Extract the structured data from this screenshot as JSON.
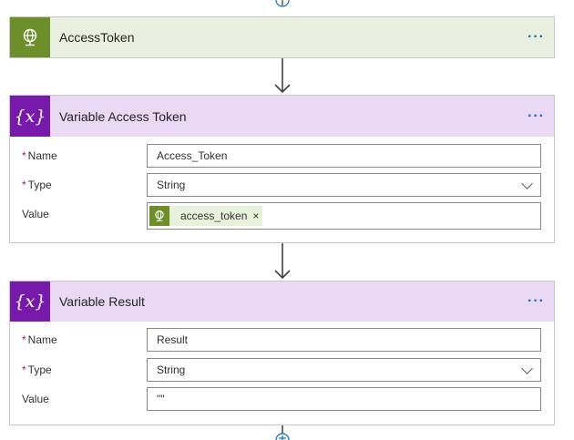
{
  "steps": {
    "access_token": {
      "title": "AccessToken",
      "icon": "globe-icon",
      "header_color": "#6c8e2b",
      "header_bg": "#e9f0df"
    },
    "var_access_token": {
      "title": "Variable Access Token",
      "icon": "variable-icon",
      "icon_text": "{x}",
      "header_color": "#7719aa",
      "header_bg": "#ead9f5",
      "name_label": "Name",
      "name_value": "Access_Token",
      "type_label": "Type",
      "type_value": "String",
      "value_label": "Value",
      "value_token": "access_token",
      "token_remove": "×"
    },
    "var_result": {
      "title": "Variable Result",
      "icon": "variable-icon",
      "icon_text": "{x}",
      "name_label": "Name",
      "name_value": "Result",
      "type_label": "Type",
      "type_value": "String",
      "value_label": "Value",
      "value_value": "\"\""
    }
  },
  "more_label": "···",
  "required_marker": "*",
  "link_color": "#0f6cbd"
}
